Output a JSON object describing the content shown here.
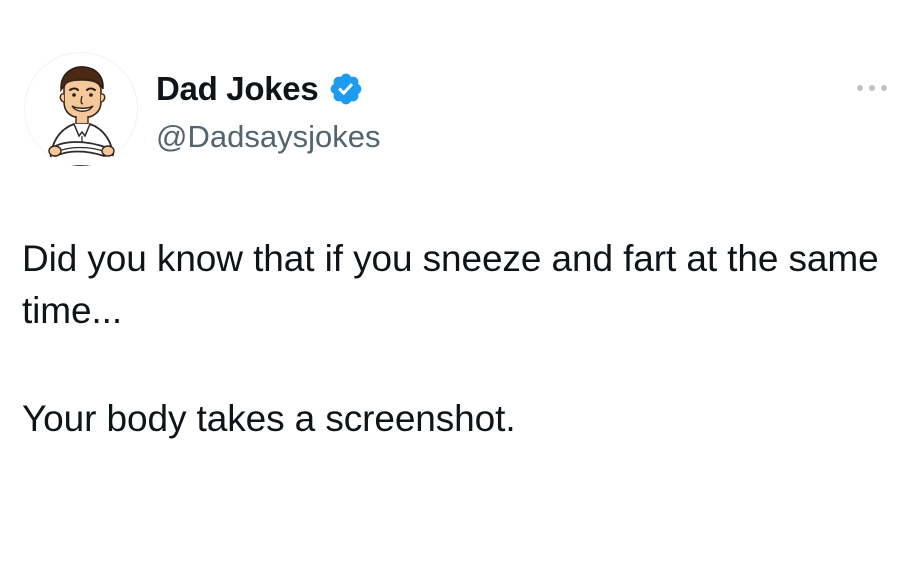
{
  "author": {
    "display_name": "Dad Jokes",
    "handle": "@Dadsaysjokes",
    "verified": true,
    "avatar_icon": "cartoon-man-arms-crossed-avatar",
    "verified_badge_icon": "verified-checkmark-badge-icon",
    "verified_color": "#1d9bf0"
  },
  "actions": {
    "more_icon": "more-options-ellipsis-icon"
  },
  "tweet": {
    "line1": "Did you know that if you sneeze and fart at the same time...",
    "line2": "Your body takes a screenshot."
  },
  "colors": {
    "text_primary": "#0f1419",
    "text_secondary": "#536471",
    "background": "#ffffff"
  }
}
